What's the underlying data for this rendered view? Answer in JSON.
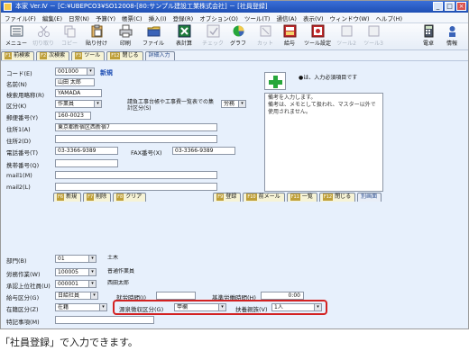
{
  "window": {
    "title": "本家 Ver.Ⅳ － [C:¥UBEPCO3¥SO12008-[80:サンプル建設工業株式会社] － [社員登録]",
    "buttons": [
      "_",
      "□",
      "×"
    ]
  },
  "menu": [
    "ファイル(F)",
    "編集(E)",
    "日常(N)",
    "予算(Y)",
    "帳票(C)",
    "挿入(I)",
    "登録(R)",
    "オプション(O)",
    "ツール(T)",
    "通信(A)",
    "表示(V)",
    "ウィンドウ(W)",
    "ヘルプ(H)"
  ],
  "toolbar": [
    {
      "label": "メニュー",
      "icon": "menu-icon",
      "enabled": true
    },
    {
      "label": "切り取り",
      "icon": "cut-icon",
      "enabled": false
    },
    {
      "label": "コピー",
      "icon": "copy-icon",
      "enabled": false
    },
    {
      "label": "貼り付け",
      "icon": "paste-icon",
      "enabled": true
    },
    {
      "label": "印刷",
      "icon": "print-icon",
      "enabled": true
    },
    {
      "label": "ファイル",
      "icon": "file-icon",
      "enabled": true
    },
    {
      "label": "表計算",
      "icon": "spreadsheet-icon",
      "enabled": true
    },
    {
      "label": "チェック",
      "icon": "check-icon",
      "enabled": false
    },
    {
      "label": "グラフ",
      "icon": "graph-icon",
      "enabled": true
    },
    {
      "label": "カット",
      "icon": "scissors-icon",
      "enabled": false
    },
    {
      "label": "給与",
      "icon": "payroll-icon",
      "enabled": true
    },
    {
      "label": "ツール設定",
      "icon": "tool-settings-icon",
      "enabled": true
    },
    {
      "label": "ツール2",
      "icon": "tool2-icon",
      "enabled": false
    },
    {
      "label": "ツール3",
      "icon": "tool3-icon",
      "enabled": false
    },
    {
      "label": "電卓",
      "icon": "calculator-icon",
      "enabled": true
    },
    {
      "label": "情報",
      "icon": "info-icon",
      "enabled": true
    }
  ],
  "top_tabs": [
    {
      "key": "F1",
      "label": "前検索"
    },
    {
      "key": "F2",
      "label": "次検索"
    },
    {
      "key": "F3",
      "label": "ツール"
    },
    {
      "key": "F12",
      "label": "閉じる"
    },
    {
      "key": "",
      "label": "詳細入力",
      "extra": true
    }
  ],
  "bottom_tabs": [
    {
      "key": "F6",
      "label": "新規"
    },
    {
      "key": "F7",
      "label": "削除"
    },
    {
      "key": "F8",
      "label": "クリア"
    },
    {
      "key": "F9",
      "label": "登録"
    },
    {
      "key": "F10",
      "label": "前メール"
    },
    {
      "key": "F11",
      "label": "一覧"
    },
    {
      "key": "F12",
      "label": "閉じる"
    },
    {
      "key": "",
      "label": "別画面",
      "extra": true
    }
  ],
  "form": {
    "code_label": "コード(E)",
    "code_value": "001000",
    "new_badge": "新規",
    "name_label": "名前(N)",
    "name_value": "山田 太郎",
    "kana_label": "検索用略称(R)",
    "kana_value": "YAMADA",
    "class_label": "区分(K)",
    "class_value": "作業員",
    "summary_label": "請負工事台帳や工事費一覧表での集計区分(S)",
    "summary_value": "労務",
    "zip_label": "郵便番号(Y)",
    "zip_value": "160-0023",
    "addr1_label": "住所1(A)",
    "addr1_value": "東京都新宿区西新宿7",
    "addr2_label": "住所2(D)",
    "addr2_value": "",
    "tel_label": "電話番号(T)",
    "tel_value": "03-3366-9389",
    "fax_label": "FAX番号(X)",
    "fax_value": "03-3366-9389",
    "mobile_label": "携帯番号(Q)",
    "mobile_value": "",
    "mail1_label": "mail1(M)",
    "mail1_value": "",
    "mail2_label": "mail2(L)",
    "mail2_value": "",
    "req_note": "●は、入力必須項目です",
    "memo_text": "備考を入力します。\n備考は、メモとして扱われ、マスター以外で使用されません。",
    "dept_label": "部門(B)",
    "dept_value": "01",
    "dept_name": "土木",
    "trade_label": "労務作業(W)",
    "trade_value": "100005",
    "trade_name": "普通作業員",
    "manager_label": "承認上位社員(U)",
    "manager_value": "000001",
    "manager_name": "西田太郎",
    "paytype_label": "給与区分(G)",
    "paytype_value": "日給社員",
    "days_label": "就労時間(J)",
    "days_value": "",
    "basehours_label": "基準労働時間(H)",
    "basehours_value": "0:00",
    "status_label": "在籍区分(Z)",
    "status_value": "在籍",
    "tax_label": "源泉徴収区分(G)",
    "tax_value": "甲欄",
    "dependents_label": "扶養親族(V)",
    "dependents_value": "1人",
    "notes_label": "特記事項(M)",
    "notes_value": ""
  },
  "caption": "「社員登録」で入力できます。"
}
